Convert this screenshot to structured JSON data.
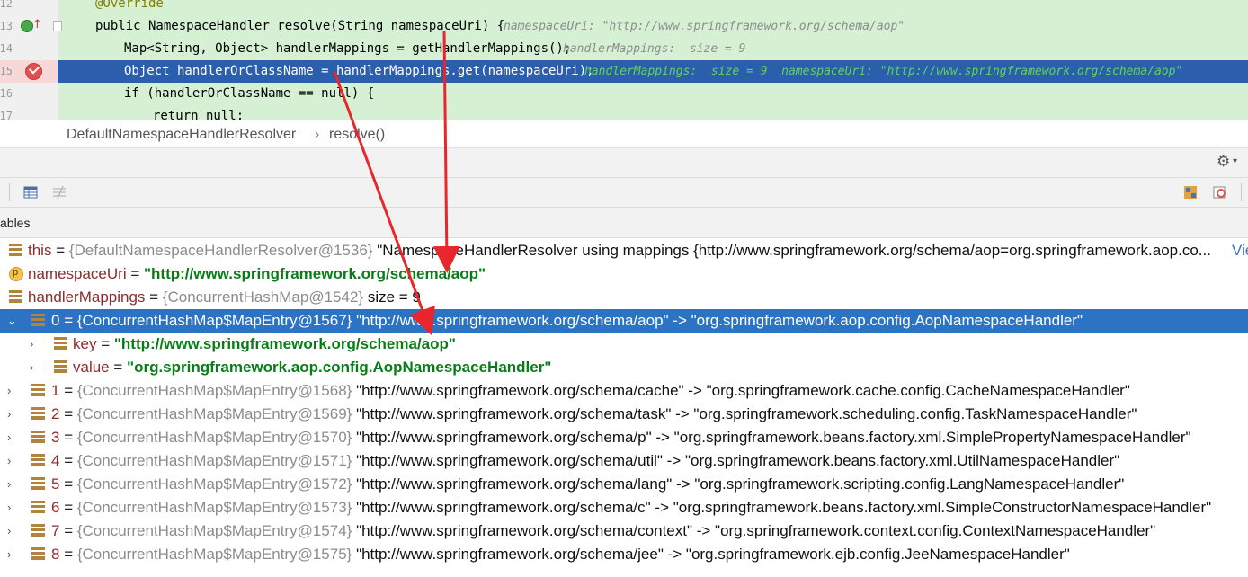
{
  "editor": {
    "lines": [
      {
        "num": "12",
        "code_indent": "    ",
        "annotation": "@Override"
      },
      {
        "num": "13",
        "code": "public NamespaceHandler resolve(String namespaceUri) {",
        "inline": "namespaceUri: \"http://www.springframework.org/schema/aop\""
      },
      {
        "num": "14",
        "code": "Map<String, Object> handlerMappings = getHandlerMappings();",
        "inline": "handlerMappings:  size = 9"
      },
      {
        "num": "15",
        "code": "Object handlerOrClassName = handlerMappings.get(namespaceUri);",
        "inline": "handlerMappings:  size = 9  namespaceUri: \"http://www.springframework.org/schema/aop\""
      },
      {
        "num": "16",
        "code": "if (handlerOrClassName == null) {"
      },
      {
        "num": "17",
        "code": "return null;"
      }
    ]
  },
  "breadcrumb": {
    "class_name": "DefaultNamespaceHandlerResolver",
    "separator": "›",
    "method": "resolve()"
  },
  "variables_panel": {
    "title": "ables"
  },
  "tree": {
    "this": {
      "name": "this",
      "eq": " = ",
      "ref": "{DefaultNamespaceHandlerResolver@1536}",
      "val": " \"NamespaceHandlerResolver using mappings {http://www.springframework.org/schema/aop=org.springframework.aop.co...",
      "view": "Vie"
    },
    "namespaceUri": {
      "name": "namespaceUri",
      "eq": " = ",
      "val": "\"http://www.springframework.org/schema/aop\""
    },
    "handlerMappings": {
      "name": "handlerMappings",
      "eq": " = ",
      "ref": "{ConcurrentHashMap@1542}",
      "val": "  size = 9"
    },
    "entries": [
      {
        "name": "0",
        "eq": " = ",
        "ref": "{ConcurrentHashMap$MapEntry@1567}",
        "val": " \"http://www.springframework.org/schema/aop\" -> \"org.springframework.aop.config.AopNamespaceHandler\""
      },
      {
        "name": "1",
        "eq": " = ",
        "ref": "{ConcurrentHashMap$MapEntry@1568}",
        "val": " \"http://www.springframework.org/schema/cache\" -> \"org.springframework.cache.config.CacheNamespaceHandler\""
      },
      {
        "name": "2",
        "eq": " = ",
        "ref": "{ConcurrentHashMap$MapEntry@1569}",
        "val": " \"http://www.springframework.org/schema/task\" -> \"org.springframework.scheduling.config.TaskNamespaceHandler\""
      },
      {
        "name": "3",
        "eq": " = ",
        "ref": "{ConcurrentHashMap$MapEntry@1570}",
        "val": " \"http://www.springframework.org/schema/p\" -> \"org.springframework.beans.factory.xml.SimplePropertyNamespaceHandler\""
      },
      {
        "name": "4",
        "eq": " = ",
        "ref": "{ConcurrentHashMap$MapEntry@1571}",
        "val": " \"http://www.springframework.org/schema/util\" -> \"org.springframework.beans.factory.xml.UtilNamespaceHandler\""
      },
      {
        "name": "5",
        "eq": " = ",
        "ref": "{ConcurrentHashMap$MapEntry@1572}",
        "val": " \"http://www.springframework.org/schema/lang\" -> \"org.springframework.scripting.config.LangNamespaceHandler\""
      },
      {
        "name": "6",
        "eq": " = ",
        "ref": "{ConcurrentHashMap$MapEntry@1573}",
        "val": " \"http://www.springframework.org/schema/c\" -> \"org.springframework.beans.factory.xml.SimpleConstructorNamespaceHandler\""
      },
      {
        "name": "7",
        "eq": " = ",
        "ref": "{ConcurrentHashMap$MapEntry@1574}",
        "val": " \"http://www.springframework.org/schema/context\" -> \"org.springframework.context.config.ContextNamespaceHandler\""
      },
      {
        "name": "8",
        "eq": " = ",
        "ref": "{ConcurrentHashMap$MapEntry@1575}",
        "val": " \"http://www.springframework.org/schema/jee\" -> \"org.springframework.ejb.config.JeeNamespaceHandler\""
      }
    ],
    "key": {
      "name": "key",
      "eq": " = ",
      "val": "\"http://www.springframework.org/schema/aop\""
    },
    "value": {
      "name": "value",
      "eq": " = ",
      "val": "\"org.springframework.aop.config.AopNamespaceHandler\""
    }
  },
  "icons": {
    "breakpoint": "breakpoint-check-icon",
    "implements": "override-icon",
    "settings": "gear-icon",
    "field": "field-icon",
    "parameter": "parameter-icon"
  },
  "colors": {
    "selection": "#2d73c4",
    "current_line": "#2b5fae",
    "string_value": "#067d17",
    "arrow": "#e8262b"
  }
}
